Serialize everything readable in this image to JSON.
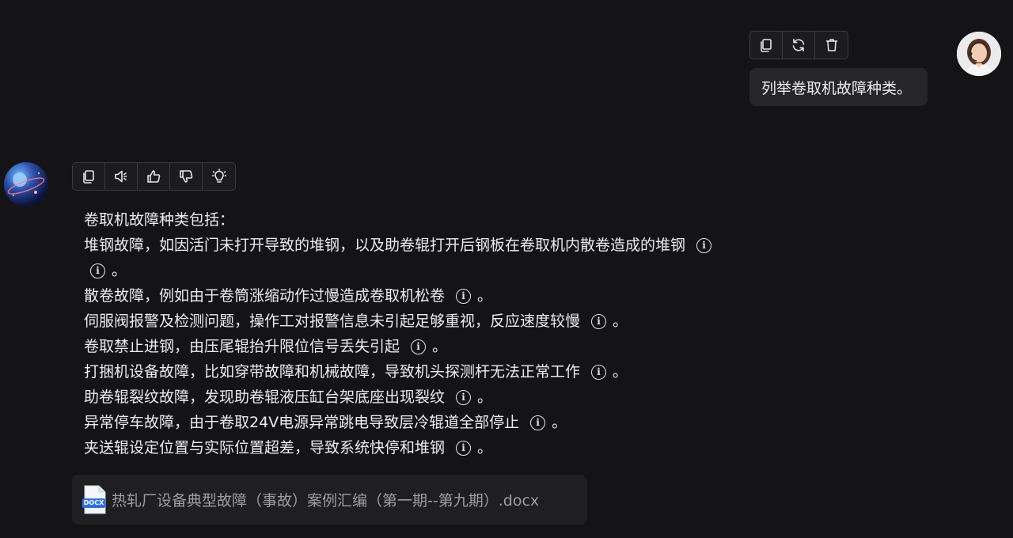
{
  "user": {
    "avatar_icon": "user-avatar-woman-headset",
    "message": "列举卷取机故障种类。",
    "actions": [
      {
        "name": "copy-button",
        "icon": "copy-icon"
      },
      {
        "name": "regenerate-button",
        "icon": "refresh-icon"
      },
      {
        "name": "delete-button",
        "icon": "trash-icon"
      }
    ]
  },
  "assistant": {
    "avatar_icon": "assistant-avatar-planet",
    "actions": [
      {
        "name": "copy-button",
        "icon": "copy-icon"
      },
      {
        "name": "read-aloud-button",
        "icon": "speaker-icon"
      },
      {
        "name": "like-button",
        "icon": "thumbs-up-icon"
      },
      {
        "name": "dislike-button",
        "icon": "thumbs-down-icon"
      },
      {
        "name": "insight-button",
        "icon": "lightbulb-icon"
      }
    ],
    "intro": "卷取机故障种类包括：",
    "items": [
      "堆钢故障，如因活门未打开导致的堆钢，以及助卷辊打开后钢板在卷取机内散卷造成的堆钢",
      "散卷故障，例如由于卷筒涨缩动作过慢造成卷取机松卷",
      "伺服阀报警及检测问题，操作工对报警信息未引起足够重视，反应速度较慢",
      "卷取禁止进钢，由压尾辊抬升限位信号丢失引起",
      "打捆机设备故障，比如穿带故障和机械故障，导致机头探测杆无法正常工作",
      "助卷辊裂纹故障，发现助卷辊液压缸台架底座出现裂纹",
      "异常停车故障，由于卷取24V电源异常跳电导致层冷辊道全部停止",
      "夹送辊设定位置与实际位置超差，导致系统快停和堆钢"
    ],
    "period": "。",
    "citation_glyph": "i",
    "attachment": {
      "icon": "docx-file-icon",
      "badge": "DOCX",
      "filename": "热轧厂设备典型故障（事故）案例汇编（第一期--第九期）.docx"
    }
  },
  "colors": {
    "background": "#141416",
    "bubble": "#26262a",
    "border": "#3a3a3e",
    "docx_blue": "#2f6fe4"
  }
}
